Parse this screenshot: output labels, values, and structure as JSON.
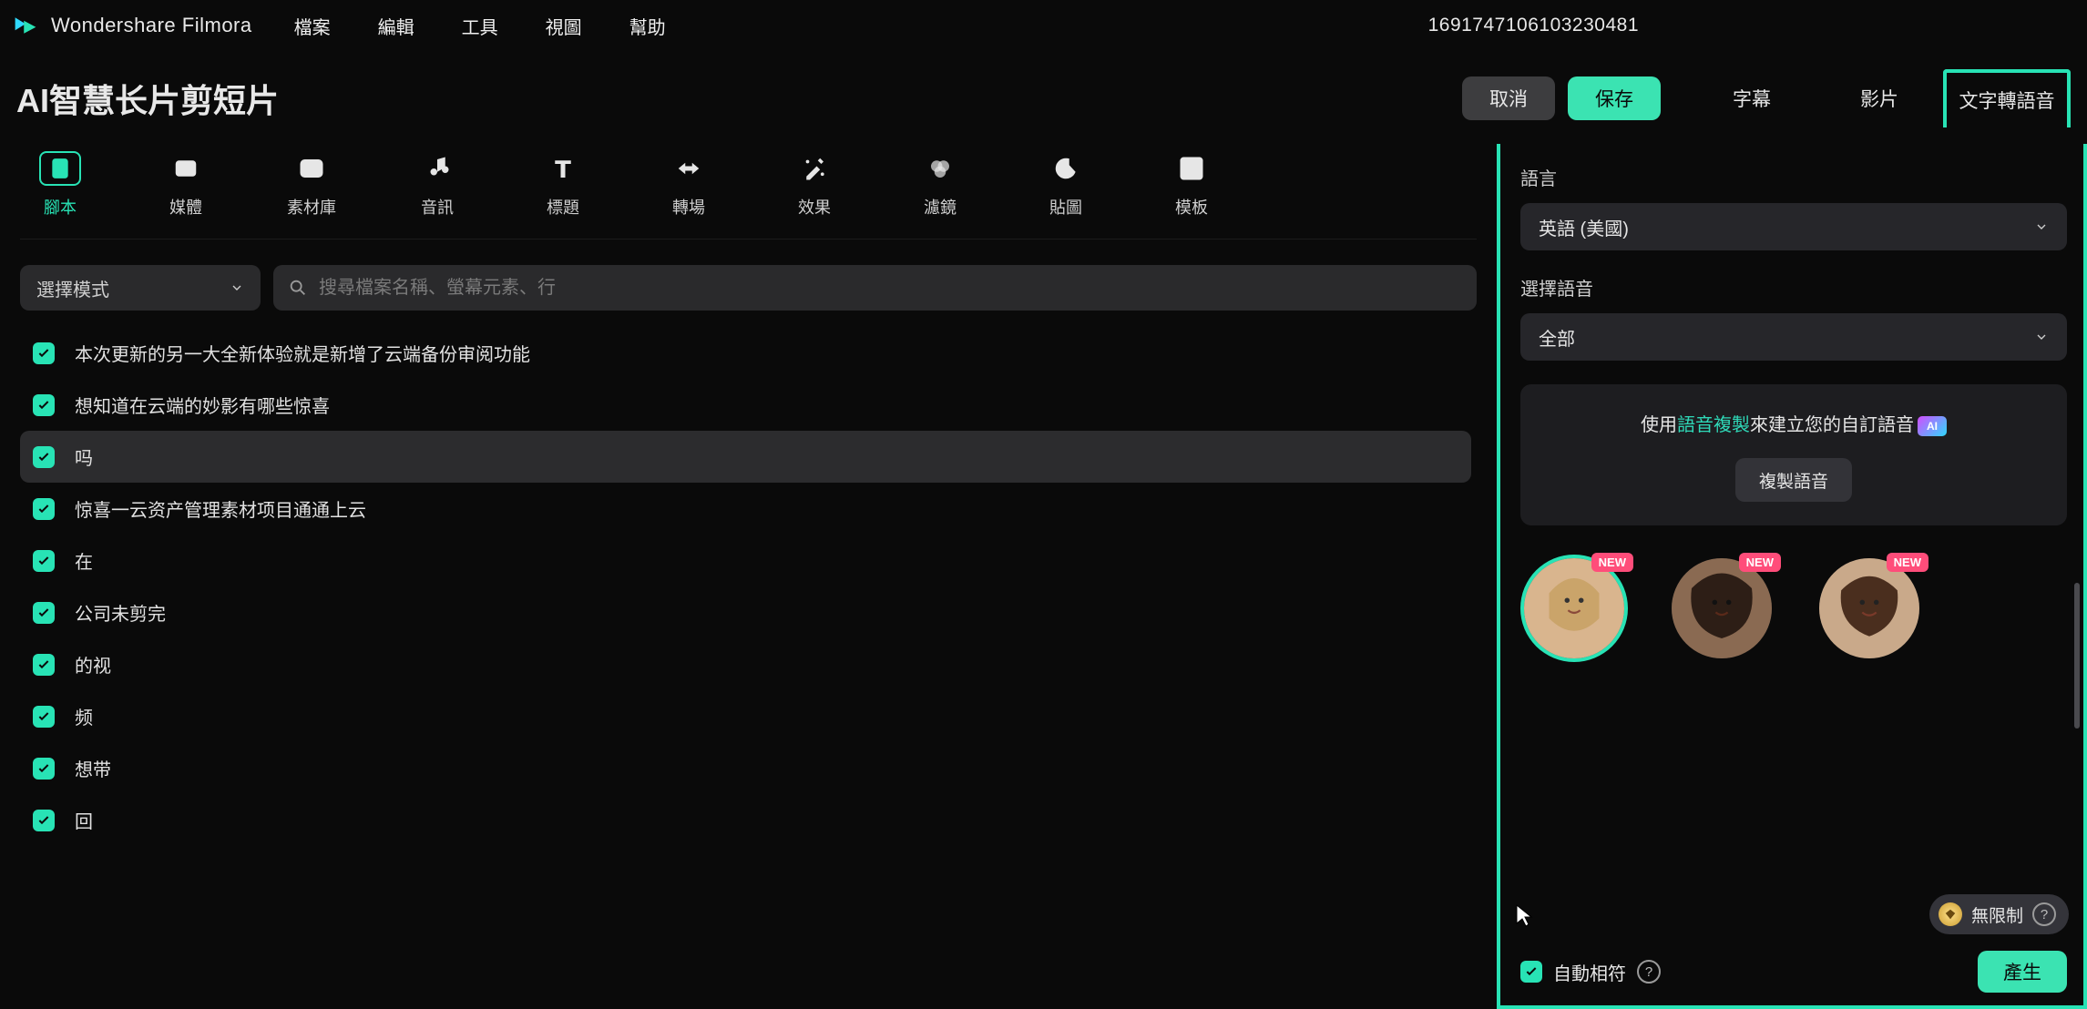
{
  "app": {
    "name": "Wondershare Filmora"
  },
  "menubar": {
    "items": [
      "檔案",
      "編輯",
      "工具",
      "視圖",
      "幫助"
    ],
    "id_number": "1691747106103230481"
  },
  "page": {
    "title": "AI智慧长片剪短片",
    "cancel": "取消",
    "save": "保存"
  },
  "right_tabs": [
    "字幕",
    "影片",
    "文字轉語音"
  ],
  "right_tab_active": 2,
  "tools": [
    {
      "label": "腳本",
      "icon": "script"
    },
    {
      "label": "媒體",
      "icon": "media"
    },
    {
      "label": "素材庫",
      "icon": "library"
    },
    {
      "label": "音訊",
      "icon": "audio"
    },
    {
      "label": "標題",
      "icon": "title"
    },
    {
      "label": "轉場",
      "icon": "transition"
    },
    {
      "label": "效果",
      "icon": "effect"
    },
    {
      "label": "濾鏡",
      "icon": "filter"
    },
    {
      "label": "貼圖",
      "icon": "sticker"
    },
    {
      "label": "模板",
      "icon": "template"
    }
  ],
  "active_tool": 0,
  "mode_select": {
    "label": "選擇模式"
  },
  "search": {
    "placeholder": "搜尋檔案名稱、螢幕元素、行"
  },
  "script_lines": [
    {
      "text": "本次更新的另一大全新体验就是新增了云端备份审阅功能",
      "checked": true
    },
    {
      "text": "想知道在云端的妙影有哪些惊喜",
      "checked": true
    },
    {
      "text": "吗",
      "checked": true,
      "selected": true
    },
    {
      "text": "惊喜一云资产管理素材项目通通上云",
      "checked": true
    },
    {
      "text": "在",
      "checked": true
    },
    {
      "text": "公司未剪完",
      "checked": true
    },
    {
      "text": "的视",
      "checked": true
    },
    {
      "text": "频",
      "checked": true
    },
    {
      "text": "想带",
      "checked": true
    },
    {
      "text": "回",
      "checked": true
    }
  ],
  "tts_panel": {
    "language_label": "語言",
    "language_value": "英語 (美國)",
    "voice_select_label": "選擇語音",
    "voice_select_value": "全部",
    "clone_prefix": "使用",
    "clone_link": "語音複製",
    "clone_suffix": "來建立您的自訂語音",
    "ai_badge": "AI",
    "clone_button": "複製語音",
    "new_badge": "NEW",
    "voices_selected": 0,
    "unlimited": "無限制",
    "auto_match": "自動相符",
    "generate": "產生"
  }
}
